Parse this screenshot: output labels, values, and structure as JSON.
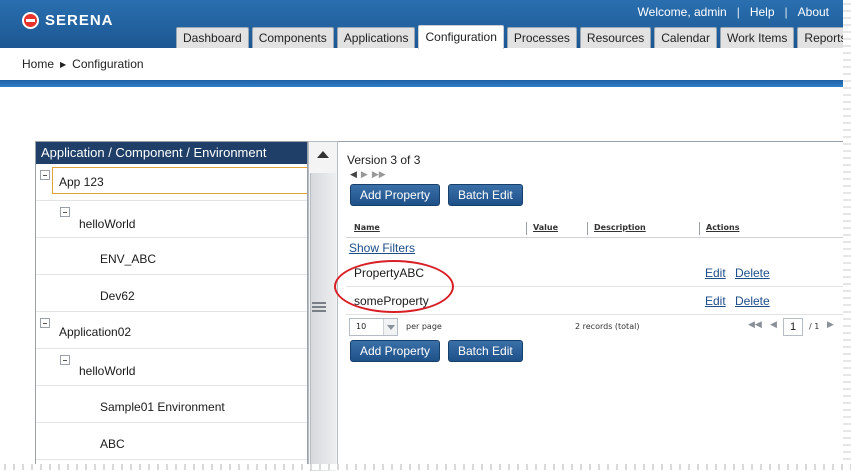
{
  "app": {
    "brand": "SERENA"
  },
  "user_nav": {
    "welcome": "Welcome, admin",
    "separator": "|",
    "help": "Help",
    "about": "About"
  },
  "tabs": [
    {
      "label": "Dashboard"
    },
    {
      "label": "Components"
    },
    {
      "label": "Applications"
    },
    {
      "label": "Configuration",
      "active": true
    },
    {
      "label": "Processes"
    },
    {
      "label": "Resources"
    },
    {
      "label": "Calendar"
    },
    {
      "label": "Work Items"
    },
    {
      "label": "Reports"
    }
  ],
  "breadcrumb": {
    "home": "Home",
    "current": "Configuration"
  },
  "tree": {
    "header": "Application / Component / Environment",
    "items": [
      {
        "label": "App 123"
      },
      {
        "label": "helloWorld"
      },
      {
        "label": "ENV_ABC"
      },
      {
        "label": "Dev62"
      },
      {
        "label": "Application02"
      },
      {
        "label": "helloWorld"
      },
      {
        "label": "Sample01 Environment"
      },
      {
        "label": "ABC"
      }
    ]
  },
  "properties": {
    "version": "Version 3 of 3",
    "add_property": "Add Property",
    "batch_edit": "Batch Edit",
    "columns": {
      "name": "Name",
      "value": "Value",
      "description": "Description",
      "actions": "Actions"
    },
    "show_filters": "Show Filters",
    "rows": [
      {
        "name": "PropertyABC",
        "edit": "Edit",
        "delete": "Delete"
      },
      {
        "name": "someProperty",
        "edit": "Edit",
        "delete": "Delete"
      }
    ],
    "pager": {
      "per_page_value": "10",
      "per_page_label": "per page",
      "records": "2 records (total)",
      "page": "1",
      "total_pages": "/ 1"
    }
  },
  "colors": {
    "header_blue": "#1c5792",
    "tree_header": "#1f3f69",
    "highlight": "#d81f26",
    "selected_outline": "#e0a23a"
  }
}
